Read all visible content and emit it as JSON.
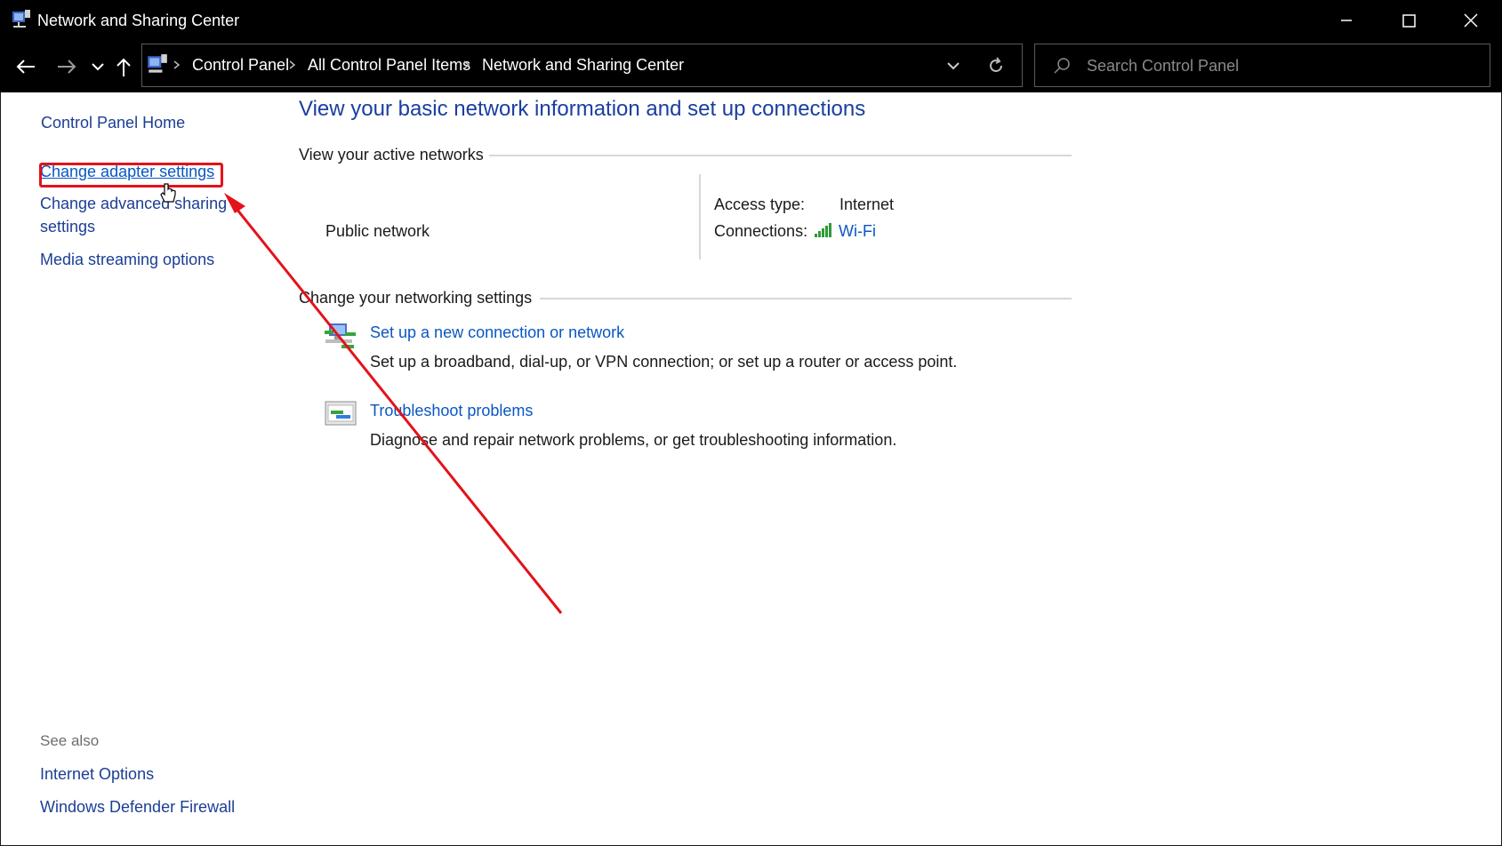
{
  "window": {
    "title": "Network and Sharing Center"
  },
  "address": {
    "crumbs": [
      "Control Panel",
      "All Control Panel Items",
      "Network and Sharing Center"
    ],
    "search_placeholder": "Search Control Panel"
  },
  "sidebar": {
    "home": "Control Panel Home",
    "links": [
      "Change adapter settings",
      "Change advanced sharing",
      "settings",
      "Media streaming options"
    ],
    "see_also_title": "See also",
    "see_also": [
      "Internet Options",
      "Windows Defender Firewall"
    ]
  },
  "main": {
    "title": "View your basic network information and set up connections",
    "active_networks_label": "View your active networks",
    "network_name": "Public network",
    "access_type_label": "Access type:",
    "access_type_value": "Internet",
    "connections_label": "Connections:",
    "connections_value": "Wi-Fi",
    "change_settings_label": "Change your networking settings",
    "tasks": [
      {
        "title": "Set up a new connection or network",
        "desc": "Set up a broadband, dial-up, or VPN connection; or set up a router or access point."
      },
      {
        "title": "Troubleshoot problems",
        "desc": "Diagnose and repair network problems, or get troubleshooting information."
      }
    ]
  },
  "colors": {
    "link": "#0a57c2",
    "annotation": "#e4121b",
    "titlebar": "#000000"
  }
}
